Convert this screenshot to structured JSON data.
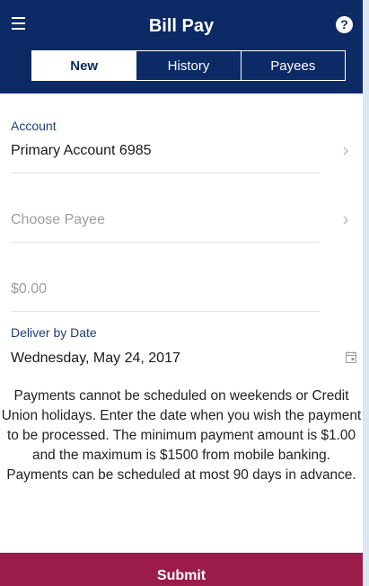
{
  "header": {
    "title": "Bill Pay",
    "menu_icon": "hamburger-menu-icon",
    "help_icon": "help-circle-icon",
    "help_glyph": "?"
  },
  "tabs": [
    {
      "label": "New",
      "active": true
    },
    {
      "label": "History",
      "active": false
    },
    {
      "label": "Payees",
      "active": false
    }
  ],
  "form": {
    "account_label": "Account",
    "account_value": "Primary Account 6985",
    "payee_placeholder": "Choose Payee",
    "amount_placeholder": "$0.00",
    "deliver_label": "Deliver by Date",
    "deliver_value": "Wednesday, May 24, 2017"
  },
  "notice": "Payments cannot be scheduled on weekends or Credit Union holidays. Enter the date when you wish the payment to be processed. The minimum payment amount is $1.00 and the maximum is $1500 from mobile banking. Payments can be scheduled at most 90 days in advance.",
  "submit_label": "Submit",
  "colors": {
    "header": "#0c2a66",
    "submit": "#9b1b4a",
    "label": "#1a3f7a",
    "side_background": "#dde6f3"
  }
}
